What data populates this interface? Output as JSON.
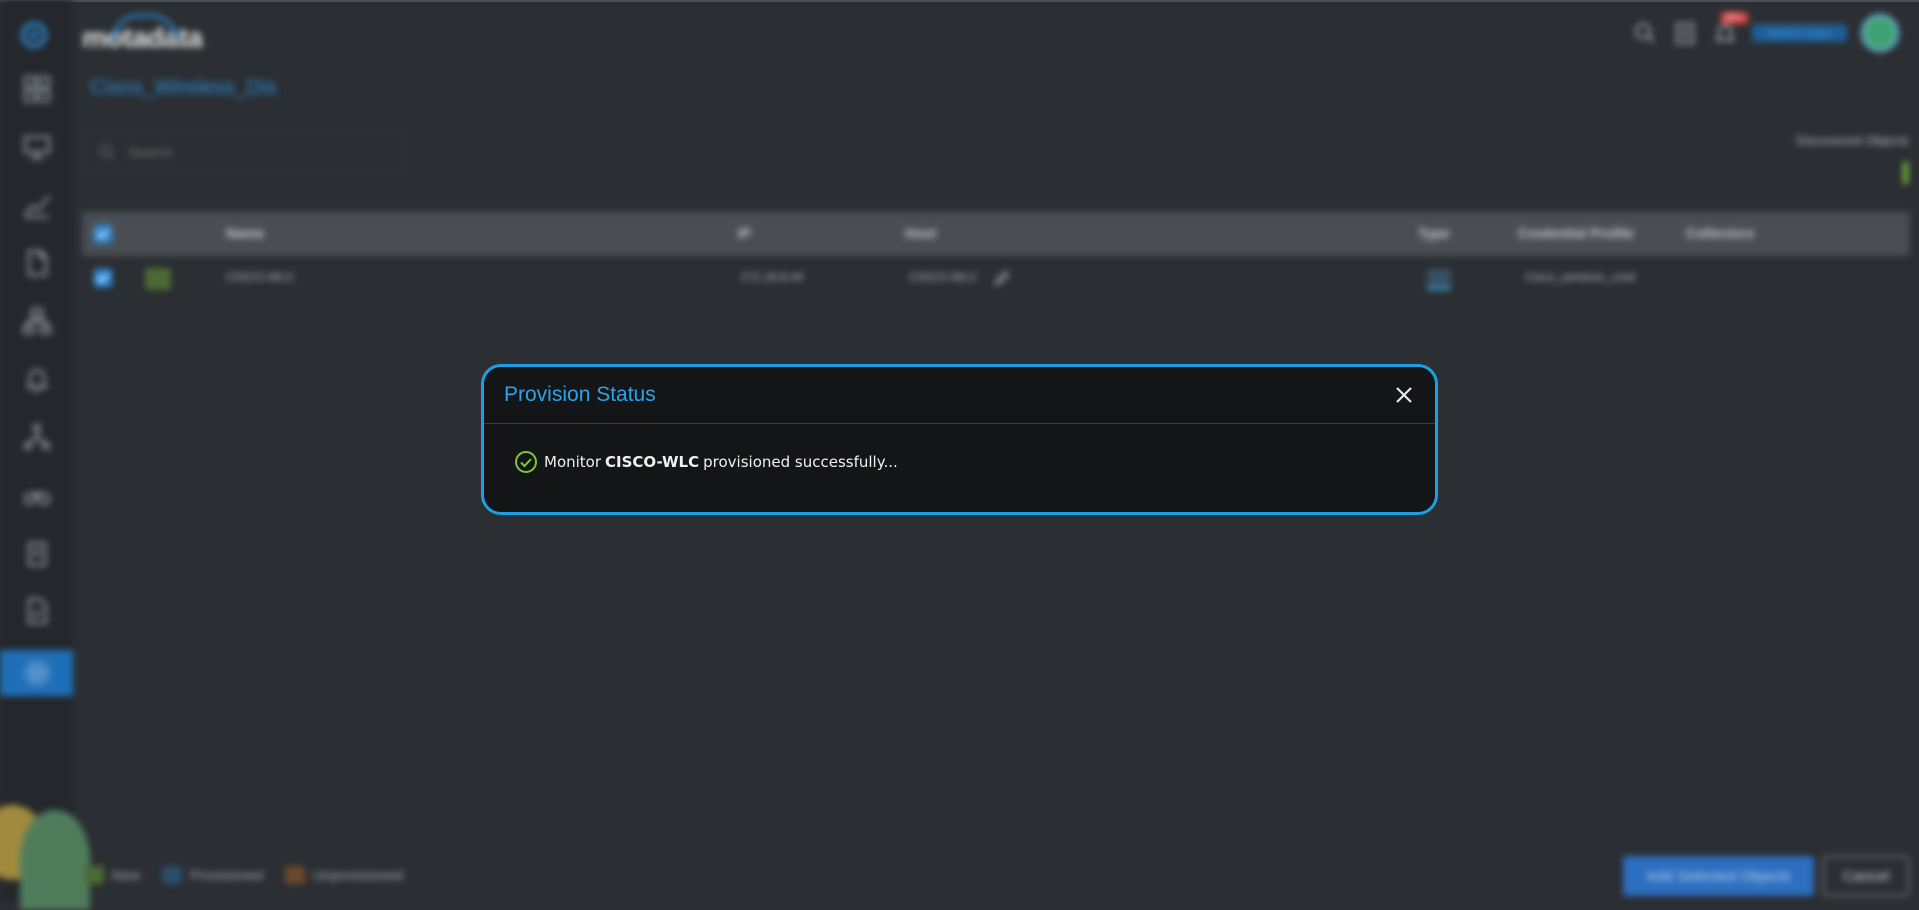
{
  "brand": {
    "name": "motadata"
  },
  "header": {
    "badge": "99+",
    "user_label": "Admin User"
  },
  "page": {
    "title": "Cisco_Wireless_Dis"
  },
  "search": {
    "placeholder": "Search"
  },
  "discovered": {
    "label": "Discovered Objects"
  },
  "grid": {
    "columns": [
      "Name",
      "IP",
      "Host",
      "Type",
      "Credential Profile",
      "Collectors"
    ],
    "rows": [
      {
        "name": "CISCO-WLC",
        "ip": "172.16.8.44",
        "host": "CISCO-WLC",
        "credential_profile": "Cisco_wireless_cred"
      }
    ]
  },
  "legend": [
    {
      "label": "New",
      "color": "#4c6a35"
    },
    {
      "label": "Provisioned",
      "color": "#2a4f6c"
    },
    {
      "label": "Unprovisioned",
      "color": "#6b4a2e"
    }
  ],
  "actions": {
    "primary": "Add Selected Objects",
    "cancel": "Cancel"
  },
  "modal": {
    "title": "Provision Status",
    "message_prefix": "Monitor",
    "monitor_name": "CISCO-WLC",
    "message_suffix": "provisioned successfully..."
  },
  "colors": {
    "accent": "#1f9fe3",
    "success": "#7ec832",
    "sidebar_active": "#1f6fb8"
  }
}
